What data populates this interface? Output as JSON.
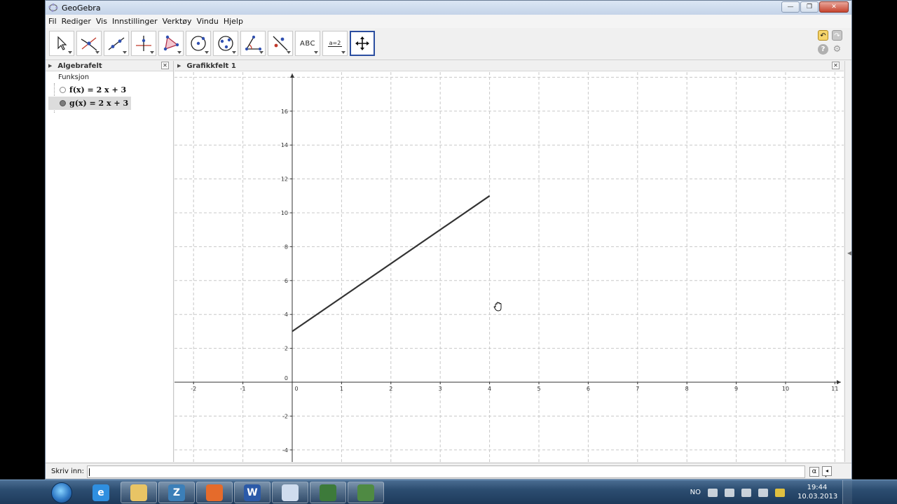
{
  "window": {
    "title": "GeoGebra",
    "controls": {
      "minimize": "—",
      "maximize": "❐",
      "close": "✕"
    }
  },
  "menu": [
    "Fil",
    "Rediger",
    "Vis",
    "Innstillinger",
    "Verktøy",
    "Vindu",
    "Hjelp"
  ],
  "toolbar": {
    "tools": [
      {
        "name": "move-tool",
        "icon": "arrow-pointer-icon"
      },
      {
        "name": "point-tool",
        "icon": "point-icon"
      },
      {
        "name": "line-tool",
        "icon": "line-through-points-icon"
      },
      {
        "name": "perpendicular-line-tool",
        "icon": "perpendicular-icon"
      },
      {
        "name": "polygon-tool",
        "icon": "polygon-icon"
      },
      {
        "name": "circle-tool",
        "icon": "circle-center-point-icon"
      },
      {
        "name": "conic-tool",
        "icon": "ellipse-icon"
      },
      {
        "name": "angle-tool",
        "icon": "angle-icon"
      },
      {
        "name": "reflect-tool",
        "icon": "reflect-icon"
      },
      {
        "name": "text-tool",
        "icon": "abc-icon",
        "label": "ABC"
      },
      {
        "name": "slider-tool",
        "icon": "slider-icon",
        "label": "a=2"
      },
      {
        "name": "move-graphics-tool",
        "icon": "move-arrows-icon",
        "active": true
      }
    ],
    "undo_icon": "undo-icon",
    "redo_icon": "redo-icon",
    "help_icon": "help-icon",
    "settings_icon": "gear-icon"
  },
  "algebra": {
    "title": "Algebrafelt",
    "category": "Funksjon",
    "items": [
      {
        "label": "f(x) = 2 x + 3",
        "selected": false,
        "visible": false
      },
      {
        "label": "g(x) = 2 x + 3",
        "selected": true,
        "visible": true
      }
    ]
  },
  "graphics": {
    "title": "Grafikkfelt 1"
  },
  "chart_data": {
    "type": "line",
    "series": [
      {
        "name": "g(x) = 2 x + 3",
        "x": [
          0,
          4
        ],
        "y": [
          3,
          11
        ],
        "color": "#333333"
      }
    ],
    "xlim": [
      -2.4,
      11.2
    ],
    "ylim": [
      -4.5,
      18
    ],
    "x_ticks": [
      -2,
      -1,
      0,
      1,
      2,
      3,
      4,
      5,
      6,
      7,
      8,
      9,
      10,
      11
    ],
    "y_ticks": [
      -4,
      -2,
      0,
      2,
      4,
      6,
      8,
      10,
      12,
      14,
      16
    ],
    "grid": true
  },
  "input": {
    "label": "Skriv inn:",
    "value": "",
    "alpha_symbol": "α",
    "spin_symbol": "▲▼"
  },
  "taskbar": {
    "apps": [
      {
        "name": "internet-explorer",
        "icon": "ie-icon",
        "glyph": "e",
        "color": "#2f8fe0"
      },
      {
        "name": "file-explorer",
        "icon": "folder-icon",
        "glyph": "",
        "color": "#e8c465"
      },
      {
        "name": "zotero",
        "icon": "zotero-icon",
        "glyph": "Z",
        "color": "#3c7fb8"
      },
      {
        "name": "firefox",
        "icon": "firefox-icon",
        "glyph": "",
        "color": "#e56b2b"
      },
      {
        "name": "word",
        "icon": "word-icon",
        "glyph": "W",
        "color": "#2b5aa8"
      },
      {
        "name": "geogebra",
        "icon": "geogebra-icon",
        "glyph": "",
        "color": "#cfdcee"
      },
      {
        "name": "app-green",
        "icon": "app-green-icon",
        "glyph": "",
        "color": "#3d7a3a"
      },
      {
        "name": "app-green-2",
        "icon": "app-green-2-icon",
        "glyph": "",
        "color": "#4f8a43"
      }
    ],
    "language": "NO",
    "time": "19:44",
    "date": "10.03.2013"
  }
}
